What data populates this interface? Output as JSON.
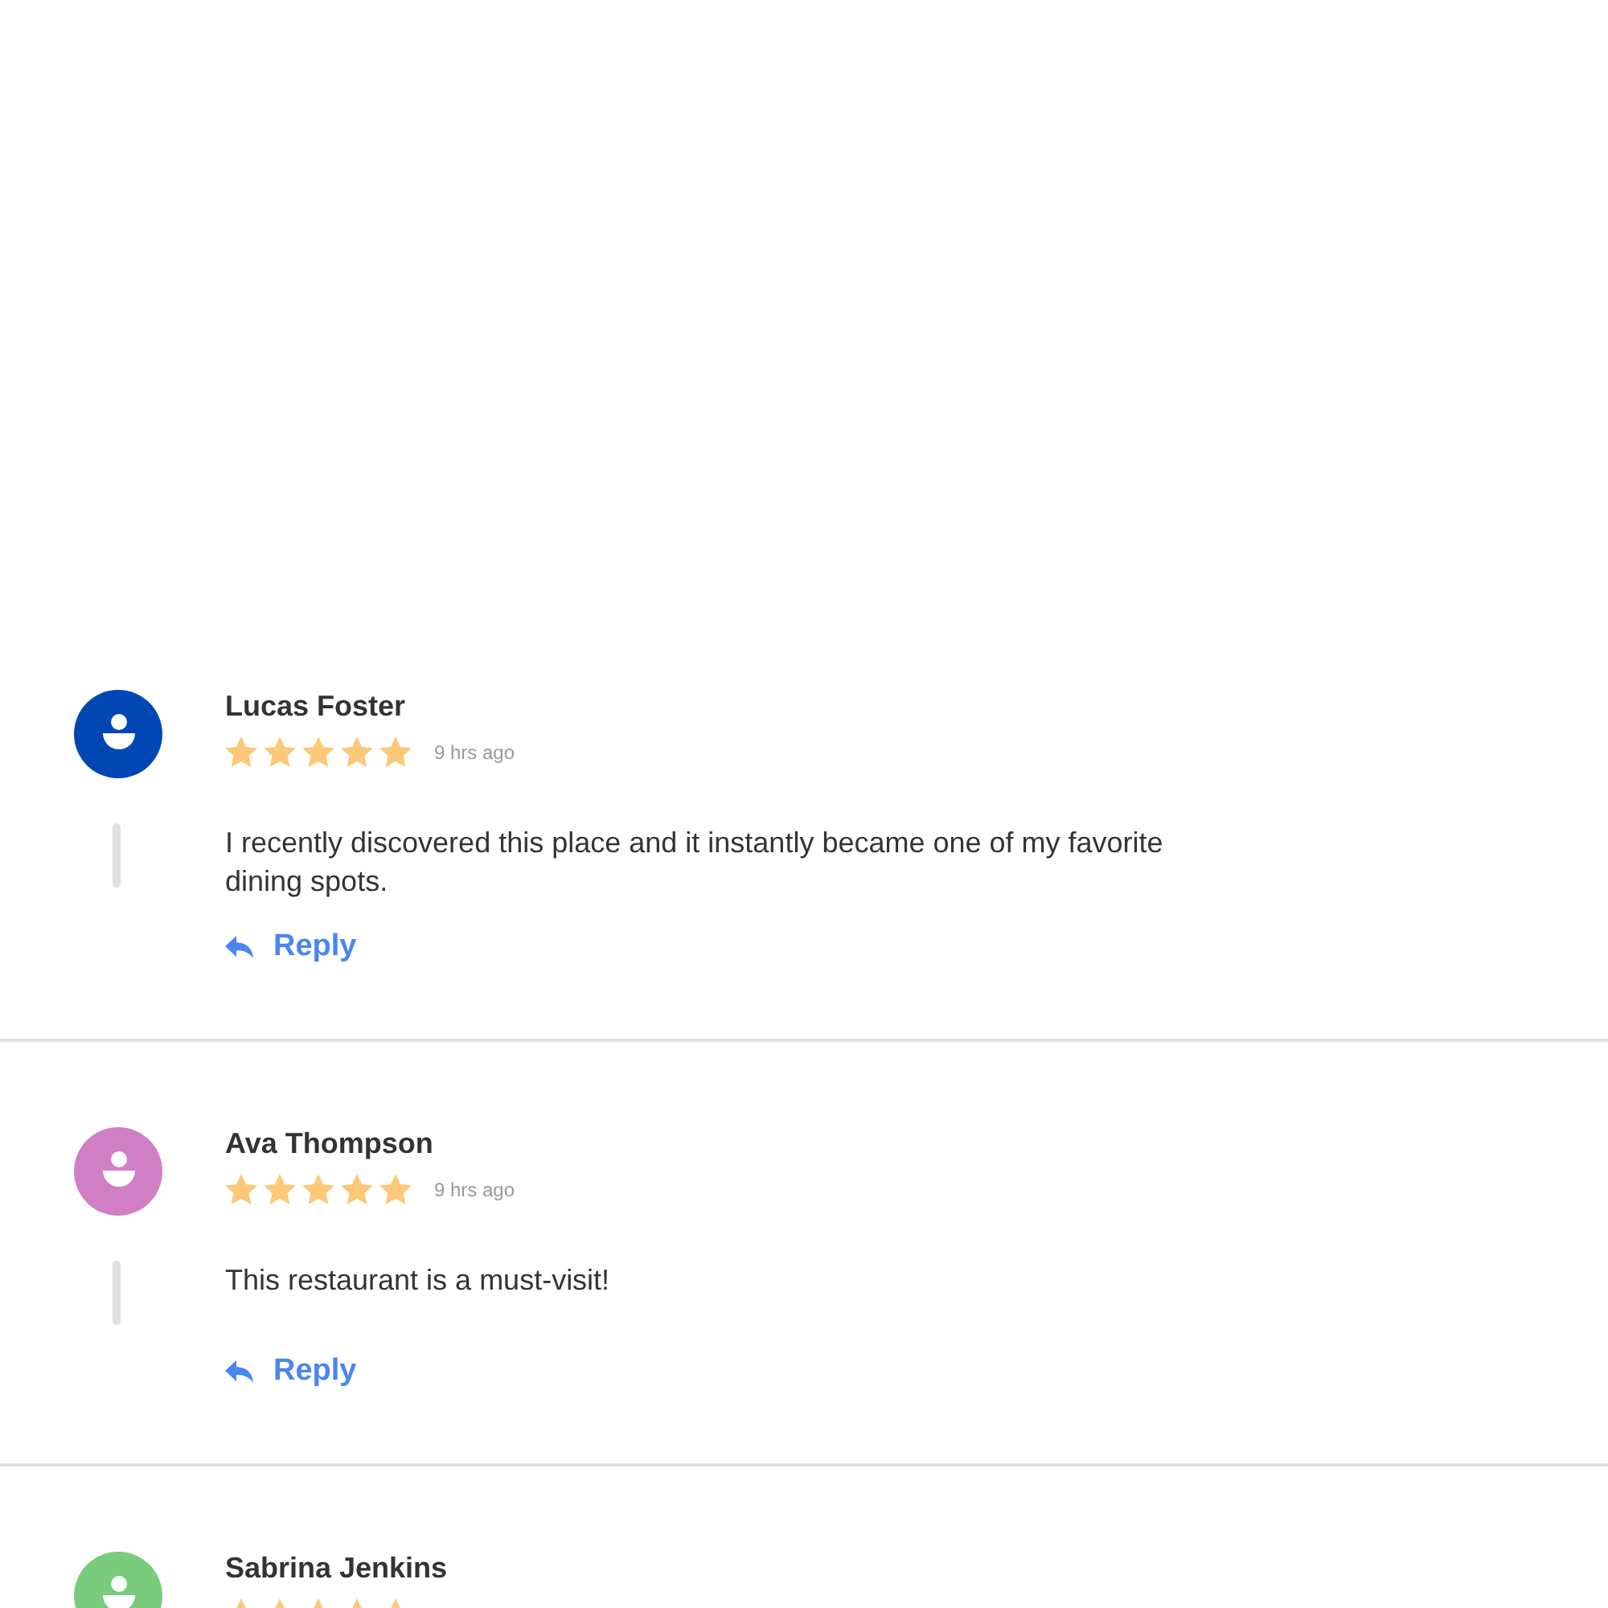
{
  "reviews": [
    {
      "author": "Lucas Foster",
      "color": "#0047b3",
      "stars": 5,
      "time": "9 hrs ago",
      "comment": "I recently discovered this place and it instantly became one of my favorite dining spots.",
      "reply": "Reply"
    },
    {
      "author": "Ava Thompson",
      "color": "#d17fc4",
      "stars": 5,
      "time": "9 hrs ago",
      "comment": "This restaurant is a must-visit!",
      "reply": "Reply"
    },
    {
      "author": "Sabrina Jenkins",
      "color": "#78cc7c",
      "stars": 5
    }
  ]
}
